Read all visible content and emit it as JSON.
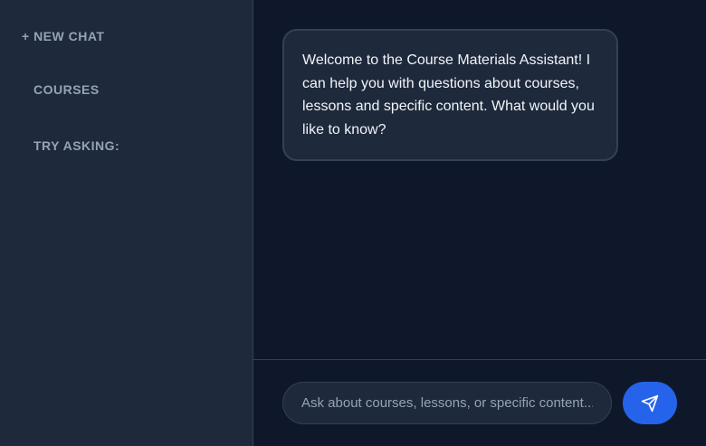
{
  "sidebar": {
    "new_chat_label": "+ NEW CHAT",
    "courses_label": "COURSES",
    "try_asking_label": "TRY ASKING:",
    "collapse_icon_glyph": ""
  },
  "chat": {
    "messages": [
      {
        "role": "assistant",
        "text": "Welcome to the Course Materials Assistant! I can help you with questions about courses, lessons and specific content. What would you like to know?"
      }
    ]
  },
  "composer": {
    "placeholder": "Ask about courses, lessons, or specific content...",
    "value": "",
    "send_icon": "send-icon"
  },
  "colors": {
    "sidebar_bg": "#1e293b",
    "main_bg": "#0f172a",
    "bubble_bg": "#1e293b",
    "accent": "#2563eb",
    "muted_text": "#94a3b8",
    "text": "#f1f5f9"
  }
}
